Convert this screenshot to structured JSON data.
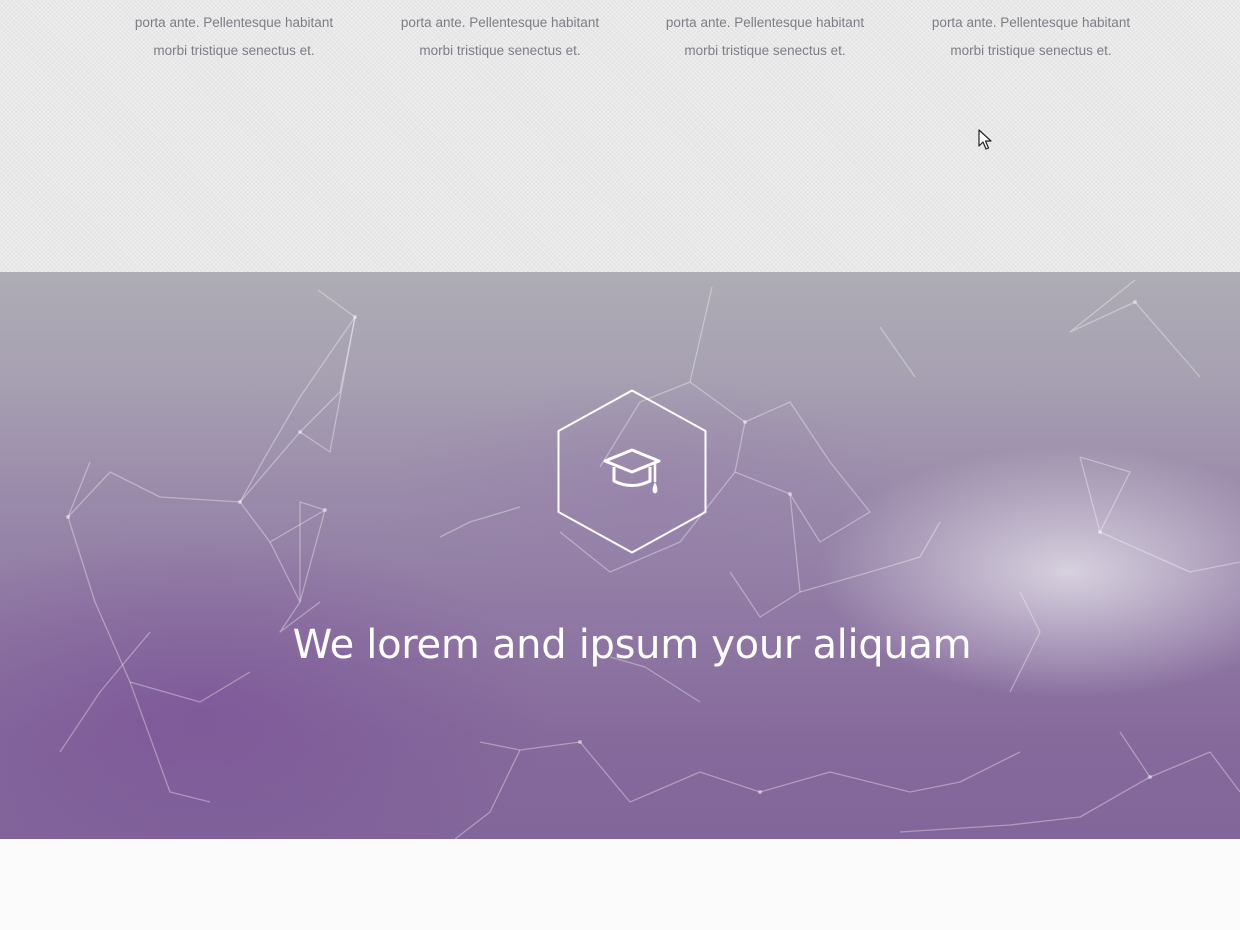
{
  "features": {
    "items": [
      {
        "line1": "porta ante. Pellentesque habitant",
        "line2": "morbi tristique senectus et."
      },
      {
        "line1": "porta ante. Pellentesque habitant",
        "line2": "morbi tristique senectus et."
      },
      {
        "line1": "porta ante. Pellentesque habitant",
        "line2": "morbi tristique senectus et."
      },
      {
        "line1": "porta ante. Pellentesque habitant",
        "line2": "morbi tristique senectus et."
      }
    ]
  },
  "hero": {
    "icon": "graduation-cap-icon",
    "title": "We lorem and ipsum your aliquam"
  },
  "colors": {
    "feature_text": "#7d7d85",
    "features_bg": "#e8e8e8",
    "hero_purple": "#82659a",
    "hero_text": "#ffffff",
    "page_bg": "#fbfbfb"
  }
}
